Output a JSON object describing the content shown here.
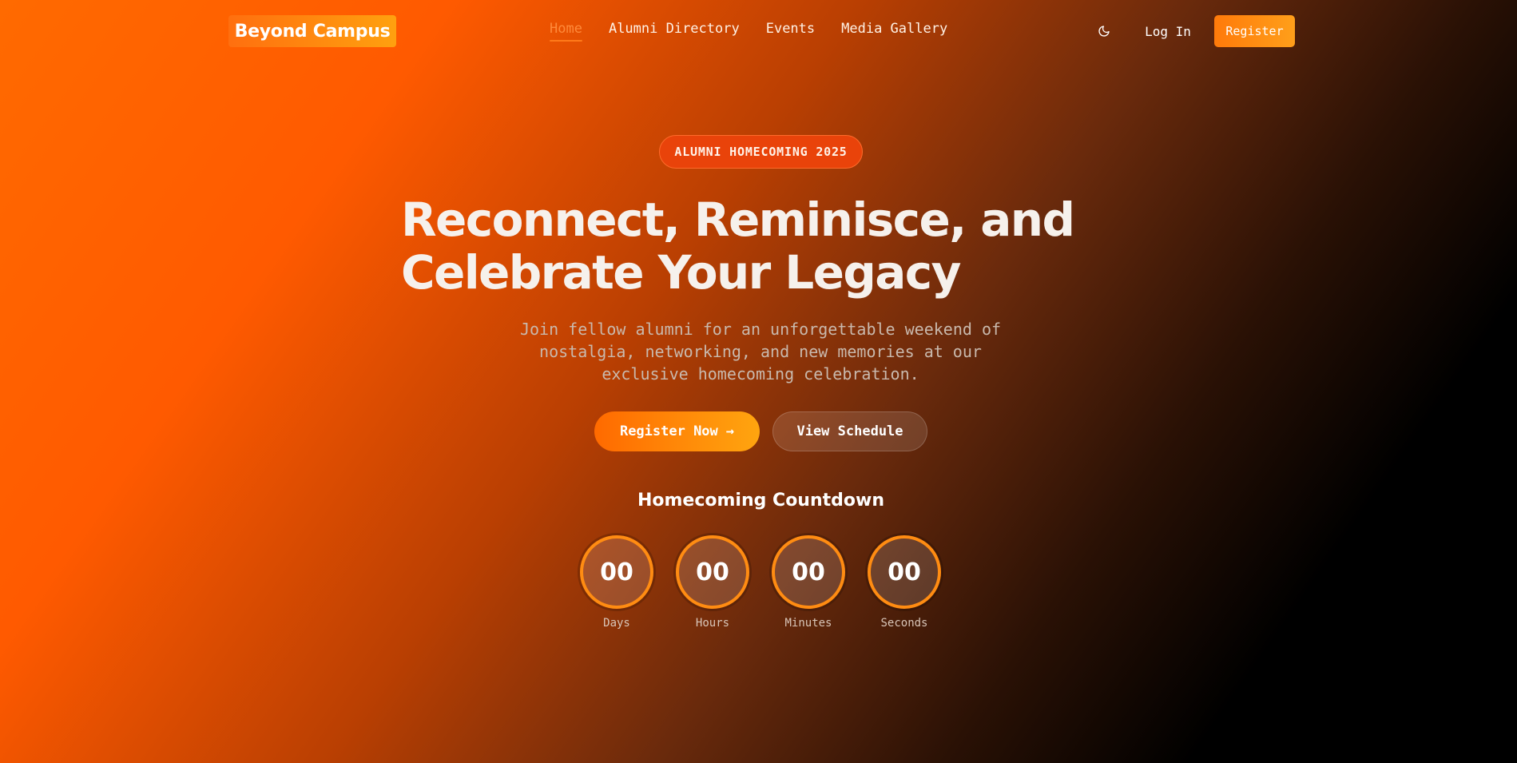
{
  "nav": {
    "logo": "Beyond Campus",
    "links": [
      "Home",
      "Alumni Directory",
      "Events",
      "Media Gallery"
    ],
    "active_link": "Home",
    "theme_icon": "moon-icon",
    "login_label": "Log In",
    "register_label": "Register"
  },
  "hero": {
    "badge": "ALUMNI HOMECOMING 2025",
    "headline_line1": "Reconnect, Reminisce, and",
    "headline_line2": "Celebrate Your Legacy",
    "subtext": "Join fellow alumni for an unforgettable weekend of nostalgia, networking, and new memories at our exclusive homecoming celebration.",
    "primary_button": "Register Now",
    "primary_button_icon": "arrow-right-icon",
    "secondary_button": "View Schedule"
  },
  "countdown": {
    "title": "Homecoming Countdown",
    "units": [
      {
        "value": "00",
        "label": "Days"
      },
      {
        "value": "00",
        "label": "Hours"
      },
      {
        "value": "00",
        "label": "Minutes"
      },
      {
        "value": "00",
        "label": "Seconds"
      }
    ]
  },
  "colors": {
    "accent": "#ff6a00",
    "accent_light": "#ffa50f",
    "background_dark": "#000000"
  }
}
